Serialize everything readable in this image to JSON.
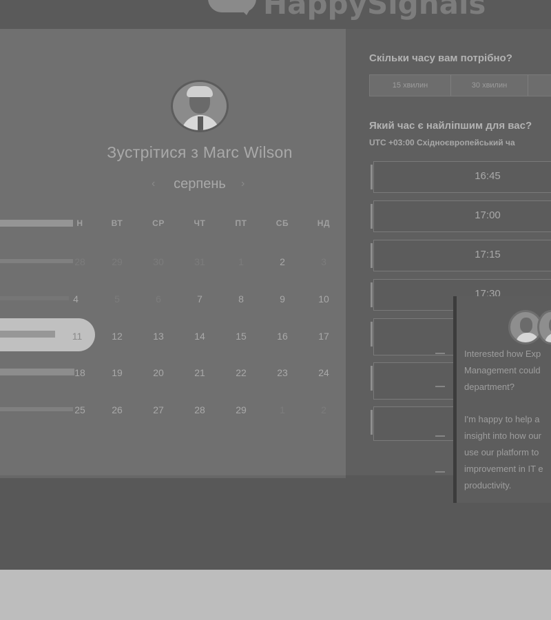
{
  "header": {
    "logo_text": "HappySignals"
  },
  "booking": {
    "title": "Зустрітися з Marc Wilson",
    "month": "серпень",
    "prev_icon": "chevron-left-icon",
    "next_icon": "chevron-right-icon",
    "weekdays": [
      "Н",
      "ВТ",
      "СР",
      "ЧТ",
      "ПТ",
      "СБ",
      "НД"
    ],
    "weeks": [
      [
        "28",
        "29",
        "30",
        "31",
        "1",
        "2",
        "3"
      ],
      [
        "4",
        "5",
        "6",
        "7",
        "8",
        "9",
        "10"
      ],
      [
        "11",
        "12",
        "13",
        "14",
        "15",
        "16",
        "17"
      ],
      [
        "18",
        "19",
        "20",
        "21",
        "22",
        "23",
        "24"
      ],
      [
        "25",
        "26",
        "27",
        "28",
        "29",
        "1",
        "2"
      ]
    ]
  },
  "duration": {
    "heading": "Скільки часу вам потрібно?",
    "options": [
      "15 хвилин",
      "30 хвилин"
    ]
  },
  "time": {
    "heading": "Який час є найліпшим для вас?",
    "timezone": "UTC +03:00 Східноєвропейський ча",
    "slots": [
      "16:45",
      "17:00",
      "17:15",
      "17:30"
    ]
  },
  "chat": {
    "lines": [
      "Interested how Exp",
      "Management could",
      "department?",
      "",
      "I'm happy to help a",
      "insight into how our",
      "use our platform to",
      "improvement in IT e",
      "productivity."
    ]
  }
}
